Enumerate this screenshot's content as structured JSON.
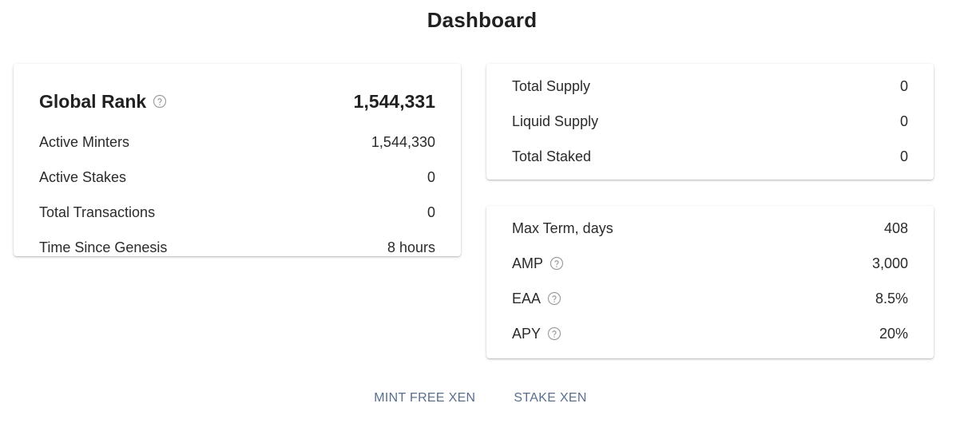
{
  "page": {
    "title": "Dashboard"
  },
  "stats": {
    "global_rank": {
      "label": "Global Rank",
      "value": "1,544,331"
    },
    "rows": [
      {
        "label": "Active Minters",
        "value": "1,544,330"
      },
      {
        "label": "Active Stakes",
        "value": "0"
      },
      {
        "label": "Total Transactions",
        "value": "0"
      },
      {
        "label": "Time Since Genesis",
        "value": "8 hours"
      }
    ]
  },
  "supply": {
    "rows": [
      {
        "label": "Total Supply",
        "value": "0"
      },
      {
        "label": "Liquid Supply",
        "value": "0"
      },
      {
        "label": "Total Staked",
        "value": "0"
      }
    ]
  },
  "params": {
    "rows": [
      {
        "label": "Max Term, days",
        "value": "408"
      },
      {
        "label": "AMP",
        "value": "3,000"
      },
      {
        "label": "EAA",
        "value": "8.5%"
      },
      {
        "label": "APY",
        "value": "20%"
      }
    ]
  },
  "actions": {
    "mint_label": "MINT FREE XEN",
    "stake_label": "STAKE XEN"
  },
  "icons": {
    "help": "help-circle-icon"
  },
  "colors": {
    "action_text": "#5a6f8c",
    "help_icon": "#9e9e9e"
  }
}
